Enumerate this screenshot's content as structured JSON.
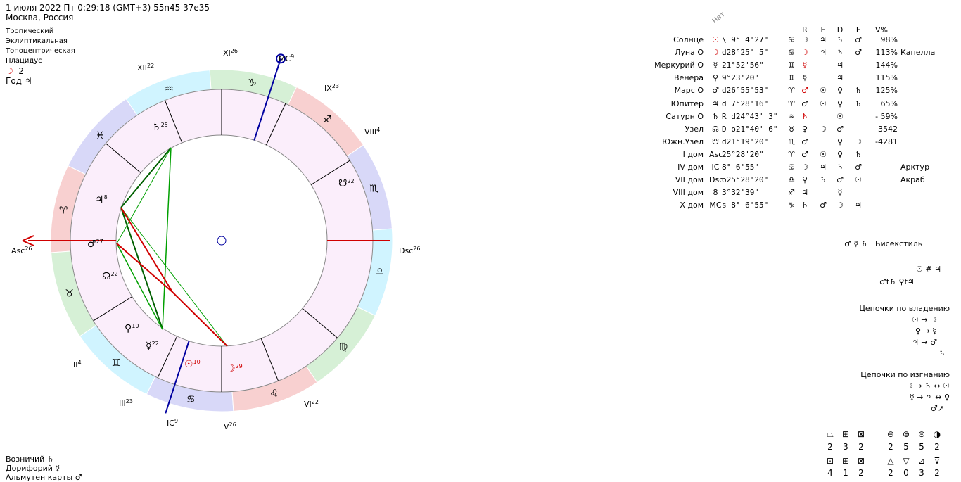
{
  "header": {
    "line1": "1 июля 2022  Пт   0:29:18 (GMT+3) 55n45  37e35",
    "line2": "Москва, Россия"
  },
  "settings": [
    "Тропический",
    "Эклиптикальная",
    "Топоцентрическая",
    "Плацидус"
  ],
  "moon_day": {
    "symbol": "☽",
    "value": "2"
  },
  "year": {
    "label": "Год",
    "symbol": "♃"
  },
  "wheel": {
    "angles": {
      "asc": "Asc",
      "asc_deg": "26",
      "dsc": "Dsc",
      "dsc_deg": "26",
      "mc": "MC",
      "mc_deg": "9",
      "ic": "IC",
      "ic_deg": "9"
    },
    "houses": [
      {
        "label": "II",
        "deg": "4"
      },
      {
        "label": "III",
        "deg": "23"
      },
      {
        "label": "V",
        "deg": "26"
      },
      {
        "label": "VI",
        "deg": "22"
      },
      {
        "label": "VIII",
        "deg": "4"
      },
      {
        "label": "IX",
        "deg": "23"
      },
      {
        "label": "XI",
        "deg": "26"
      },
      {
        "label": "XII",
        "deg": "22"
      }
    ],
    "signs": [
      "♈",
      "♉",
      "♊",
      "♋",
      "♌",
      "♍",
      "♎",
      "♏",
      "♐",
      "♑",
      "♒",
      "♓"
    ],
    "planets": [
      {
        "glyph": "♄",
        "deg": "25",
        "note": "R"
      },
      {
        "glyph": "♃",
        "deg": "8"
      },
      {
        "glyph": "♂",
        "deg": "27"
      },
      {
        "glyph": "☊",
        "deg": "22",
        "note": "D"
      },
      {
        "glyph": "♀",
        "deg": "10"
      },
      {
        "glyph": "☿",
        "deg": "22"
      },
      {
        "glyph": "☉",
        "deg": "10"
      },
      {
        "glyph": "☽",
        "deg": "29"
      },
      {
        "glyph": "☋",
        "deg": "22"
      }
    ]
  },
  "table": {
    "nat_label": "Нат",
    "col_headers": [
      "R",
      "E",
      "D",
      "F",
      "V%"
    ],
    "rows": [
      {
        "name": "Солнце",
        "flag": "",
        "glyph": "☉",
        "pos": "\\  9° 4'27\"",
        "sign": "♋",
        "r": "☽",
        "e": "♃",
        "d": "♄",
        "f": "♂",
        "v": "98%",
        "star": ""
      },
      {
        "name": "Луна",
        "flag": "O",
        "glyph": "☽",
        "pos": "d28°25' 5\"",
        "sign": "♋",
        "r": "☽",
        "e": "♃",
        "d": "♄",
        "f": "♂",
        "v": "113%",
        "star": "Капелла"
      },
      {
        "name": "Меркурий",
        "flag": "O",
        "glyph": "☿",
        "pos": "21°52'56\"",
        "sign": "♊",
        "r": "☿",
        "e": "",
        "d": "♃",
        "f": "",
        "v": "144%",
        "star": ""
      },
      {
        "name": "Венера",
        "flag": "",
        "glyph": "♀",
        "pos": "9°23'20\"",
        "sign": "♊",
        "r": "☿",
        "e": "",
        "d": "♃",
        "f": "",
        "v": "115%",
        "star": ""
      },
      {
        "name": "Марс",
        "flag": "O",
        "glyph": "♂",
        "pos": "d26°55'53\"",
        "sign": "♈",
        "r": "♂",
        "e": "☉",
        "d": "♀",
        "f": "♄",
        "v": "125%",
        "star": ""
      },
      {
        "name": "Юпитер",
        "flag": "",
        "glyph": "♃",
        "pos": "d 7°28'16\"",
        "sign": "♈",
        "r": "♂",
        "e": "☉",
        "d": "♀",
        "f": "♄",
        "v": "65%",
        "star": ""
      },
      {
        "name": "Сатурн",
        "flag": "O",
        "glyph": "♄",
        "pos": "R d24°43' 3\"",
        "sign": "♒",
        "r": "♄",
        "e": "",
        "d": "☉",
        "f": "",
        "v": "- 59%",
        "star": ""
      },
      {
        "name": "Узел",
        "flag": "",
        "glyph": "☊",
        "pos": "D o21°40' 6\"",
        "sign": "♉",
        "r": "♀",
        "e": "☽",
        "d": "♂",
        "f": "",
        "v": "3542",
        "star": ""
      },
      {
        "name": "Южн.Узел",
        "flag": "",
        "glyph": "☋",
        "pos": "d21°19'20\"",
        "sign": "♏",
        "r": "♂",
        "e": "",
        "d": "♀",
        "f": "☽",
        "v": "-4281",
        "star": ""
      },
      {
        "name": "I дом",
        "flag": "",
        "glyph": "Asc",
        "pos": "25°28'20\"",
        "sign": "♈",
        "r": "♂",
        "e": "☉",
        "d": "♀",
        "f": "♄",
        "v": "",
        "star": ""
      },
      {
        "name": "IV дом",
        "flag": "",
        "glyph": "IC",
        "pos": "8° 6'55\"",
        "sign": "♋",
        "r": "☽",
        "e": "♃",
        "d": "♄",
        "f": "♂",
        "v": "",
        "star": "Арктур"
      },
      {
        "name": "VII дом",
        "flag": "",
        "glyph": "Dsc",
        "pos": "o25°28'20\"",
        "sign": "♎",
        "r": "♀",
        "e": "♄",
        "d": "♂",
        "f": "☉",
        "v": "",
        "star": "Акраб"
      },
      {
        "name": "VIII дом",
        "flag": "",
        "glyph": "8",
        "pos": "3°32'39\"",
        "sign": "♐",
        "r": "♃",
        "e": "",
        "d": "☿",
        "f": "",
        "v": "",
        "star": ""
      },
      {
        "name": "X дом",
        "flag": "",
        "glyph": "MC",
        "pos": "s 8° 6'55\"",
        "sign": "♑",
        "r": "♄",
        "e": "♂",
        "d": "☽",
        "f": "♃",
        "v": "",
        "star": ""
      }
    ]
  },
  "aspects": {
    "bisextile_symbols": "♂ ☿ ♄",
    "bisextile_label": "Бисекстиль",
    "line_a": "☉ # ♃",
    "line_b": "♂t♄ ♀t♃"
  },
  "chains_ownership": {
    "title": "Цепочки по владению",
    "lines": [
      "☉ → ☽",
      "♀ → ☿",
      "♃ → ♂",
      "♄"
    ]
  },
  "chains_exile": {
    "title": "Цепочки по изгнанию",
    "lines": [
      "☽ → ♄ ↔ ☉",
      "☿ → ♃ ↔ ♀",
      "♂↗"
    ]
  },
  "bottom_left": {
    "vozn_label": "Возничий",
    "vozn_glyph": "♄",
    "dor_label": "Дорифорий",
    "dor_glyph": "☿",
    "alm_label": "Альмутен карты",
    "alm_glyph": "♂"
  },
  "element_counts": {
    "top": [
      {
        "sym": "⏢",
        "n": "2"
      },
      {
        "sym": "⊞",
        "n": "3"
      },
      {
        "sym": "⊠",
        "n": "2"
      },
      {
        "sym": "⊖",
        "n": "2"
      },
      {
        "sym": "⊜",
        "n": "5"
      },
      {
        "sym": "⊝",
        "n": "5"
      },
      {
        "sym": "◑",
        "n": "2"
      }
    ],
    "bottom": [
      {
        "sym": "⊡",
        "n": "4"
      },
      {
        "sym": "⊞",
        "n": "1"
      },
      {
        "sym": "⊠",
        "n": "2"
      },
      {
        "sym": "△",
        "n": "2"
      },
      {
        "sym": "▽",
        "n": "0"
      },
      {
        "sym": "⊿",
        "n": "3"
      },
      {
        "sym": "⊽",
        "n": "2"
      }
    ]
  },
  "colors": {
    "red": "#d00000",
    "blue": "#0000a0",
    "green": "#00a000",
    "darkgreen": "#006000"
  }
}
